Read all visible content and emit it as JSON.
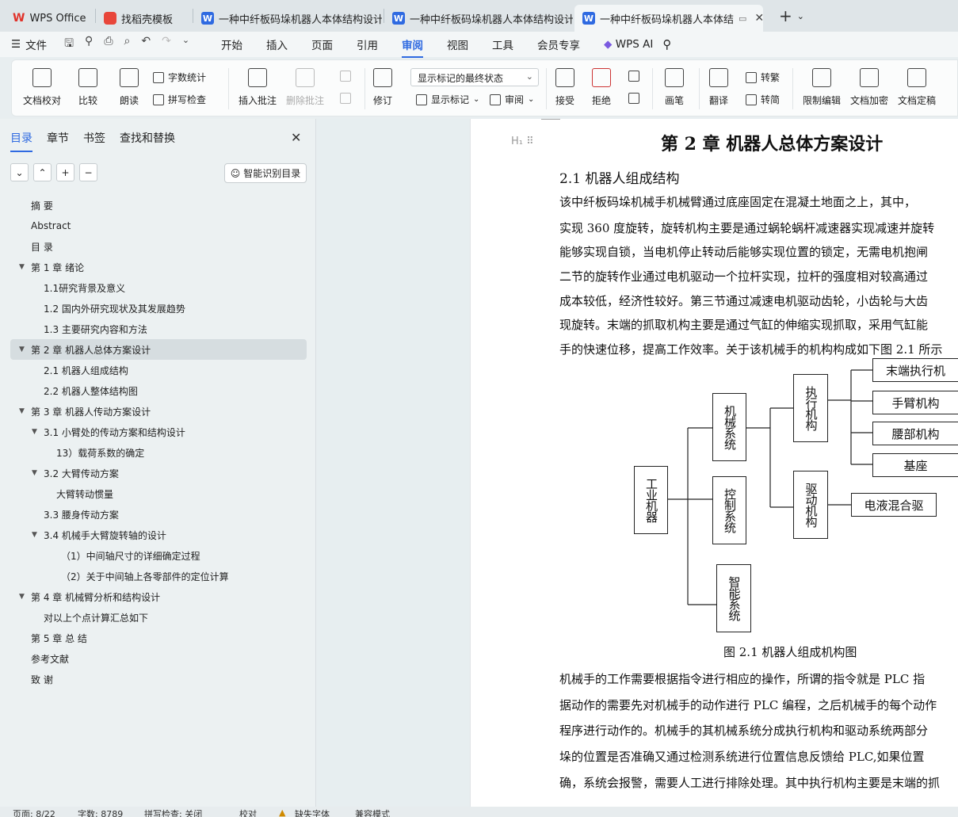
{
  "tabs": {
    "wps": "WPS Office",
    "template": "找稻壳模板",
    "doc1": "一种中纤板码垛机器人本体结构设计",
    "doc2": "一种中纤板码垛机器人本体结构设计",
    "doc3": "一种中纤板码垛机器人本体结"
  },
  "menu": {
    "file": "文件",
    "items": [
      "开始",
      "插入",
      "页面",
      "引用",
      "审阅",
      "视图",
      "工具",
      "会员专享"
    ],
    "active": "审阅",
    "ai": "WPS AI"
  },
  "ribbon": {
    "doc_check": "文档校对",
    "compare": "比较",
    "read": "朗读",
    "word_count": "字数统计",
    "spell_check": "拼写检查",
    "insert_comment": "插入批注",
    "delete_comment": "删除批注",
    "revise": "修订",
    "display_select": "显示标记的最终状态",
    "show_markup": "显示标记",
    "review": "审阅",
    "accept": "接受",
    "reject": "拒绝",
    "pen": "画笔",
    "translate": "翻译",
    "to_simplified": "转繁",
    "to_traditional": "转简",
    "restrict_edit": "限制编辑",
    "doc_encrypt": "文档加密",
    "doc_final": "文档定稿"
  },
  "nav": {
    "tabs": [
      "目录",
      "章节",
      "书签",
      "查找和替换"
    ],
    "smart_toc": "智能识别目录",
    "toc": [
      {
        "text": "摘  要",
        "level": 1,
        "expand": false
      },
      {
        "text": "Abstract",
        "level": 1,
        "expand": false
      },
      {
        "text": "目  录",
        "level": 1,
        "expand": false
      },
      {
        "text": "第 1 章   绪论",
        "level": 1,
        "expand": true
      },
      {
        "text": "1.1研究背景及意义",
        "level": 2,
        "expand": false
      },
      {
        "text": "1.2  国内外研究现状及其发展趋势",
        "level": 2,
        "expand": false
      },
      {
        "text": "1.3  主要研究内容和方法",
        "level": 2,
        "expand": false
      },
      {
        "text": "第 2 章   机器人总体方案设计",
        "level": 1,
        "expand": true,
        "selected": true
      },
      {
        "text": "2.1 机器人组成结构",
        "level": 2,
        "expand": false
      },
      {
        "text": "2.2 机器人整体结构图",
        "level": 2,
        "expand": false
      },
      {
        "text": "第 3 章  机器人传动方案设计",
        "level": 1,
        "expand": true
      },
      {
        "text": "3.1 小臂处的传动方案和结构设计",
        "level": 2,
        "expand": true
      },
      {
        "text": "13）载荷系数的确定",
        "level": 3,
        "expand": false
      },
      {
        "text": "3.2 大臂传动方案",
        "level": 2,
        "expand": true
      },
      {
        "text": "大臂转动惯量",
        "level": 3,
        "expand": false
      },
      {
        "text": "3.3 腰身传动方案",
        "level": 2,
        "expand": false
      },
      {
        "text": "3.4 机械手大臂旋转轴的设计",
        "level": 2,
        "expand": true
      },
      {
        "text": "（1）中间轴尺寸的详细确定过程",
        "level": 4,
        "expand": false
      },
      {
        "text": "（2）关于中间轴上各零部件的定位计算",
        "level": 4,
        "expand": false
      },
      {
        "text": "第 4 章  机械臂分析和结构设计",
        "level": 1,
        "expand": true
      },
      {
        "text": "对以上个点计算汇总如下",
        "level": 2,
        "expand": false
      },
      {
        "text": "第 5 章  总  结",
        "level": 1,
        "expand": false
      },
      {
        "text": "参考文献",
        "level": 1,
        "expand": false
      },
      {
        "text": "致  谢",
        "level": 1,
        "expand": false
      }
    ]
  },
  "doc": {
    "chapter_title": "第 2 章    机器人总体方案设计",
    "section_title": "2.1 机器人组成结构",
    "para1": [
      "    该中纤板码垛机械手机械臂通过底座固定在混凝土地面之上，其中，",
      "实现 360 度旋转，旋转机构主要是通过蜗轮蜗杆减速器实现减速并旋转",
      "能够实现自锁，当电机停止转动后能够实现位置的锁定，无需电机抱闸",
      "二节的旋转作业通过电机驱动一个拉杆实现，拉杆的强度相对较高通过",
      "成本较低，经济性较好。第三节通过减速电机驱动齿轮，小齿轮与大齿",
      "现旋转。末端的抓取机构主要是通过气缸的伸缩实现抓取，采用气缸能",
      "手的快速位移，提高工作效率。关于该机械手的机构构成如下图 2.1 所示"
    ],
    "diagram": {
      "root": "工业机器",
      "mech": "机械系统",
      "control": "控制系统",
      "smart": "智能系统",
      "exec": "执行机构",
      "drive": "驱动机构",
      "end": "末端执行机",
      "arm": "手臂机构",
      "waist": "腰部机构",
      "base": "基座",
      "hybrid": "电液混合驱"
    },
    "caption": "图 2.1    机器人组成机构图",
    "para2": [
      "    机械手的工作需要根据指令进行相应的操作，所谓的指令就是 PLC 指",
      "据动作的需要先对机械手的动作进行 PLC 编程，之后机械手的每个动作",
      "程序进行动作的。机械手的其机械系统分成执行机构和驱动系统两部分",
      "垛的位置是否准确又通过检测系统进行位置信息反馈给 PLC,如果位置",
      "确，系统会报警，需要人工进行排除处理。其中执行机构主要是末端的抓"
    ]
  },
  "status": {
    "page": "页面: 8/22",
    "words": "字数: 8789",
    "spell": "拼写检查: 关闭",
    "proof": "校对",
    "missing_font": "缺失字体",
    "compat": "兼容模式"
  }
}
